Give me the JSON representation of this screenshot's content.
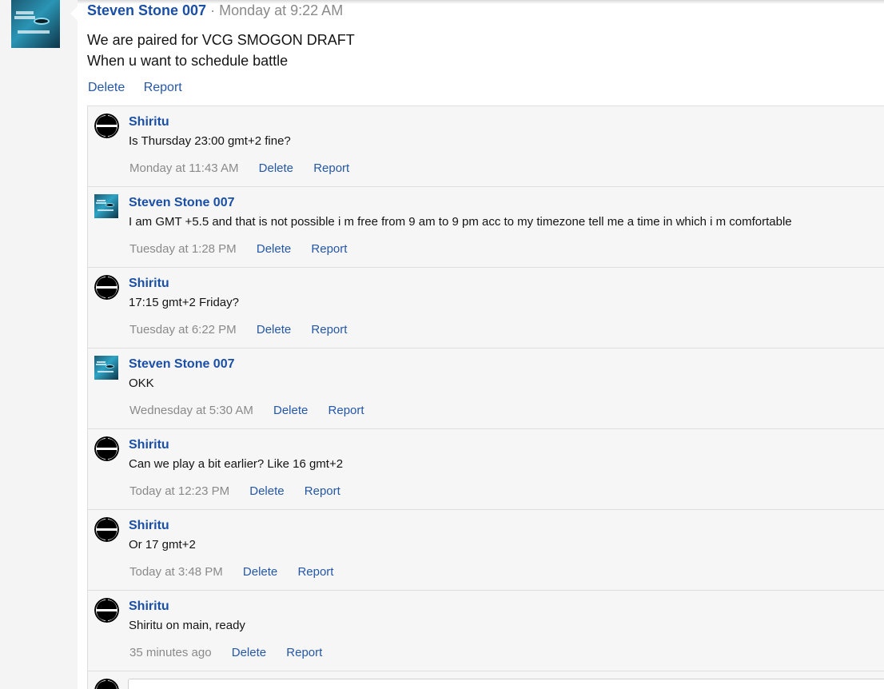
{
  "post": {
    "author": "Steven Stone 007",
    "separator": "·",
    "time": "Monday at 9:22 AM",
    "body_lines": [
      "We are paired for VCG SMOGON DRAFT",
      "When u want to schedule battle"
    ],
    "actions": {
      "delete": "Delete",
      "report": "Report"
    }
  },
  "comments": [
    {
      "author": "Shiritu",
      "avatar": "smash-ball-icon",
      "text": "Is Thursday 23:00 gmt+2 fine?",
      "time": "Monday at 11:43 AM",
      "delete": "Delete",
      "report": "Report"
    },
    {
      "author": "Steven Stone 007",
      "avatar": "dragon-avatar-icon",
      "text": "I am GMT +5.5 and that is not possible i m free from 9 am to 9 pm acc to my timezone tell me a time in which i m comfortable",
      "time": "Tuesday at 1:28 PM",
      "delete": "Delete",
      "report": "Report"
    },
    {
      "author": "Shiritu",
      "avatar": "smash-ball-icon",
      "text": "17:15 gmt+2 Friday?",
      "time": "Tuesday at 6:22 PM",
      "delete": "Delete",
      "report": "Report"
    },
    {
      "author": "Steven Stone 007",
      "avatar": "dragon-avatar-icon",
      "text": "OKK",
      "time": "Wednesday at 5:30 AM",
      "delete": "Delete",
      "report": "Report"
    },
    {
      "author": "Shiritu",
      "avatar": "smash-ball-icon",
      "text": "Can we play a bit earlier? Like 16 gmt+2",
      "time": "Today at 12:23 PM",
      "delete": "Delete",
      "report": "Report"
    },
    {
      "author": "Shiritu",
      "avatar": "smash-ball-icon",
      "text": "Or 17 gmt+2",
      "time": "Today at 3:48 PM",
      "delete": "Delete",
      "report": "Report"
    },
    {
      "author": "Shiritu",
      "avatar": "smash-ball-icon",
      "text": "Shiritu on main, ready",
      "time": "35 minutes ago",
      "delete": "Delete",
      "report": "Report"
    }
  ],
  "colors": {
    "link": "#2557a7",
    "author": "#1a4fa8",
    "muted": "#8a8a8a",
    "comment_bg": "#f6f6f6"
  }
}
